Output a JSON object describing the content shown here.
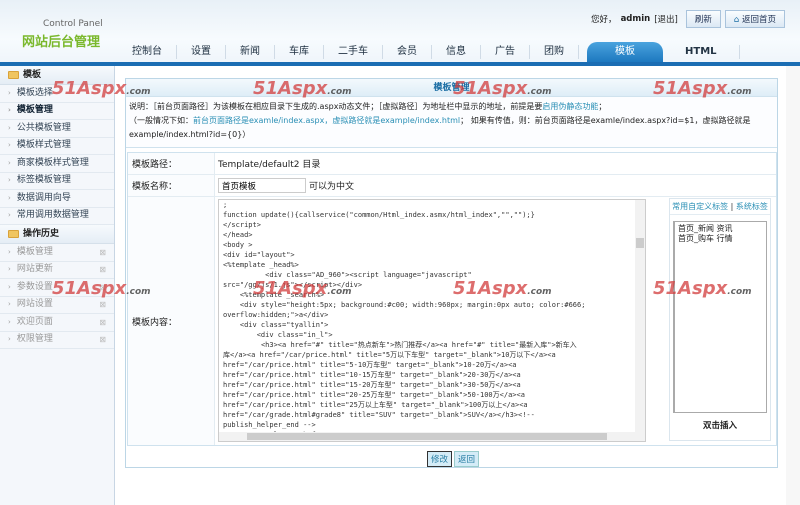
{
  "header": {
    "brand_en": "Control Panel",
    "brand_cn": "网站后台管理",
    "greeting": "您好，",
    "user": "admin",
    "logout": "[退出]",
    "refresh": "刷新",
    "home": "返回首页"
  },
  "nav": [
    "控制台",
    "设置",
    "新闻",
    "车库",
    "二手车",
    "会员",
    "信息",
    "广告",
    "团购",
    "模板",
    "HTML"
  ],
  "sidebar": {
    "section1": "模板",
    "items1": [
      "模板选择",
      "模板管理",
      "公共模板管理",
      "模板样式管理",
      "商家模板样式管理",
      "标签模板管理",
      "数据调用向导",
      "常用调用数据管理"
    ],
    "section2": "操作历史",
    "items2": [
      "模板管理",
      "网站更新",
      "参数设置",
      "网站设置",
      "欢迎页面",
      "权限管理"
    ]
  },
  "main": {
    "title": "模板管理",
    "desc1_a": "说明：［前台页面路径］为该模板在相应目录下生成的.aspx动态文件；［虚拟路径］为地址栏中显示的地址，前提是要",
    "desc1_link": "启用伪静态功能",
    "desc1_b": "；",
    "desc2_a": "（一般情况下如：",
    "desc2_link1": "前台页面路径是examle/index.aspx，虚拟路径就是example/index.html",
    "desc2_b": "；  如果有传值，则：前台页面路径是examle/index.aspx?id=$1，虚拟路径就是example/index.html?id={0}）",
    "path_label": "模板路径：",
    "path_value": "Template/default2 目录",
    "name_label": "模板名称：",
    "name_value": "首页模板",
    "name_hint": "可以为中文",
    "content_label": "模板内容：",
    "code": ";\nfunction update(){callservice(\"common/Html_index.asmx/html_index\",\"\",\"\");}\n</script>\n</head>\n<body >\n<div id=\"layout\">\n<%template _head%>\n          <div class=\"AD_960\"><script language=\"javascript\"\nsrc=\"/gg/js/1.js\"></script></div>\n    <%template _search%>\n    <div style=\"height:5px; background:#c00; width:960px; margin:0px auto; color:#666;\noverflow:hidden;\">a</div>\n    <div class=\"tyallin\">\n        <div class=\"in_l\">\n         <h3><a href=\"#\" title=\"热点新车\">热门推荐</a><a href=\"#\" title=\"最新入库\">新车入\n库</a><a href=\"/car/price.html\" title=\"5万以下车型\" target=\"_blank\">10万以下</a><a\nhref=\"/car/price.html\" title=\"5-10万车型\" target=\"_blank\">10-20万</a><a\nhref=\"/car/price.html\" title=\"10-15万车型\" target=\"_blank\">20-30万</a><a\nhref=\"/car/price.html\" title=\"15-20万车型\" target=\"_blank\">30-50万</a><a\nhref=\"/car/price.html\" title=\"20-25万车型\" target=\"_blank\">50-100万</a><a\nhref=\"/car/price.html\" title=\"25万以上车型\" target=\"_blank\">100万以上</a><a\nhref=\"/car/grade.html#grade8\" title=\"SUV\" target=\"_blank\">SUV</a></h3><!--\npublish_helper_end -->\n        <p class=\"thefst\">",
    "tag_tab1": "常用自定义标签",
    "tag_sep": " | ",
    "tag_tab2": "系统标签",
    "tags": [
      "首页_新闻 资讯",
      "首页_购车 行情"
    ],
    "insert_label": "双击插入",
    "btn_modify": "修改",
    "btn_back": "返回"
  },
  "watermark": {
    "main": "51Aspx",
    "suffix": ".com"
  }
}
